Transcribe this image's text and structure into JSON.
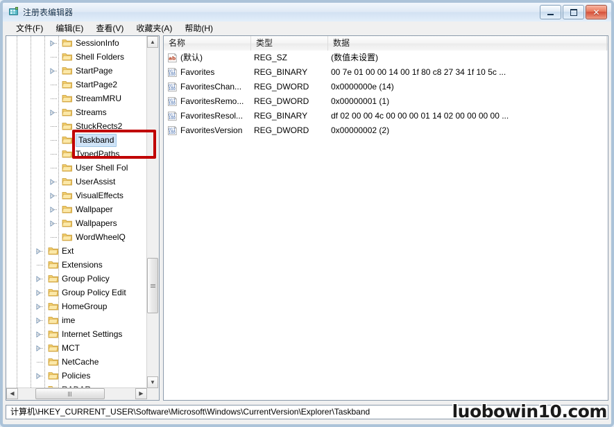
{
  "window": {
    "title": "注册表编辑器",
    "icon": "regedit-icon",
    "minimize_label": "最小化",
    "maximize_label": "最大化",
    "close_label": "关闭"
  },
  "menu": {
    "items": [
      {
        "label": "文件(F)",
        "name": "menu-file"
      },
      {
        "label": "编辑(E)",
        "name": "menu-edit"
      },
      {
        "label": "查看(V)",
        "name": "menu-view"
      },
      {
        "label": "收藏夹(A)",
        "name": "menu-favorites"
      },
      {
        "label": "帮助(H)",
        "name": "menu-help"
      }
    ]
  },
  "tree": {
    "items": [
      {
        "label": "SessionInfo",
        "indent": 4,
        "expandable": true,
        "selected": false
      },
      {
        "label": "Shell Folders",
        "indent": 4,
        "expandable": false,
        "selected": false
      },
      {
        "label": "StartPage",
        "indent": 4,
        "expandable": true,
        "selected": false
      },
      {
        "label": "StartPage2",
        "indent": 4,
        "expandable": false,
        "selected": false
      },
      {
        "label": "StreamMRU",
        "indent": 4,
        "expandable": false,
        "selected": false
      },
      {
        "label": "Streams",
        "indent": 4,
        "expandable": true,
        "selected": false
      },
      {
        "label": "StuckRects2",
        "indent": 4,
        "expandable": false,
        "selected": false
      },
      {
        "label": "Taskband",
        "indent": 4,
        "expandable": false,
        "selected": true
      },
      {
        "label": "TypedPaths",
        "indent": 4,
        "expandable": false,
        "selected": false
      },
      {
        "label": "User Shell Fol",
        "indent": 4,
        "expandable": false,
        "selected": false
      },
      {
        "label": "UserAssist",
        "indent": 4,
        "expandable": true,
        "selected": false
      },
      {
        "label": "VisualEffects",
        "indent": 4,
        "expandable": true,
        "selected": false
      },
      {
        "label": "Wallpaper",
        "indent": 4,
        "expandable": true,
        "selected": false
      },
      {
        "label": "Wallpapers",
        "indent": 4,
        "expandable": true,
        "selected": false
      },
      {
        "label": "WordWheelQ",
        "indent": 4,
        "expandable": false,
        "selected": false
      },
      {
        "label": "Ext",
        "indent": 3,
        "expandable": true,
        "selected": false
      },
      {
        "label": "Extensions",
        "indent": 3,
        "expandable": false,
        "selected": false
      },
      {
        "label": "Group Policy",
        "indent": 3,
        "expandable": true,
        "selected": false
      },
      {
        "label": "Group Policy Edit",
        "indent": 3,
        "expandable": true,
        "selected": false
      },
      {
        "label": "HomeGroup",
        "indent": 3,
        "expandable": true,
        "selected": false
      },
      {
        "label": "ime",
        "indent": 3,
        "expandable": true,
        "selected": false
      },
      {
        "label": "Internet Settings",
        "indent": 3,
        "expandable": true,
        "selected": false
      },
      {
        "label": "MCT",
        "indent": 3,
        "expandable": true,
        "selected": false
      },
      {
        "label": "NetCache",
        "indent": 3,
        "expandable": false,
        "selected": false
      },
      {
        "label": "Policies",
        "indent": 3,
        "expandable": true,
        "selected": false
      },
      {
        "label": "RADAR",
        "indent": 3,
        "expandable": false,
        "selected": false
      }
    ]
  },
  "list": {
    "columns": [
      {
        "label": "名称",
        "name": "column-name"
      },
      {
        "label": "类型",
        "name": "column-type"
      },
      {
        "label": "数据",
        "name": "column-data"
      }
    ],
    "rows": [
      {
        "name": "(默认)",
        "type": "REG_SZ",
        "data": "(数值未设置)",
        "icon": "string-value-icon"
      },
      {
        "name": "Favorites",
        "type": "REG_BINARY",
        "data": "00 7e 01 00 00 14 00 1f 80 c8 27 34 1f 10 5c ...",
        "icon": "binary-value-icon"
      },
      {
        "name": "FavoritesChan...",
        "type": "REG_DWORD",
        "data": "0x0000000e (14)",
        "icon": "binary-value-icon"
      },
      {
        "name": "FavoritesRemo...",
        "type": "REG_DWORD",
        "data": "0x00000001 (1)",
        "icon": "binary-value-icon"
      },
      {
        "name": "FavoritesResol...",
        "type": "REG_BINARY",
        "data": "df 02 00 00 4c 00 00 00 01 14 02 00 00 00 00 ...",
        "icon": "binary-value-icon"
      },
      {
        "name": "FavoritesVersion",
        "type": "REG_DWORD",
        "data": "0x00000002 (2)",
        "icon": "binary-value-icon"
      }
    ]
  },
  "status": {
    "path": "计算机\\HKEY_CURRENT_USER\\Software\\Microsoft\\Windows\\CurrentVersion\\Explorer\\Taskband"
  },
  "annotation": {
    "color": "#c00000",
    "target": "Taskband"
  },
  "watermark": {
    "text": "luobowin10.com"
  }
}
